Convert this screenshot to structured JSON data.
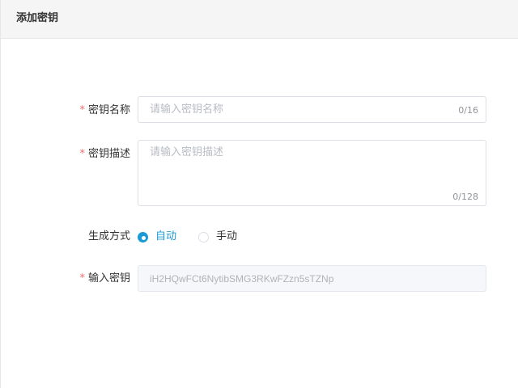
{
  "header": {
    "title": "添加密钥"
  },
  "form": {
    "name": {
      "label": "密钥名称",
      "placeholder": "请输入密钥名称",
      "counter": "0/16",
      "required": "*"
    },
    "description": {
      "label": "密钥描述",
      "placeholder": "请输入密钥描述",
      "counter": "0/128",
      "required": "*"
    },
    "mode": {
      "label": "生成方式",
      "options": [
        {
          "label": "自动",
          "checked": true
        },
        {
          "label": "手动",
          "checked": false
        }
      ]
    },
    "key": {
      "label": "输入密钥",
      "value": "iH2HQwFCt6NytibSMG3RKwFZzn5sTZNp",
      "required": "*"
    }
  },
  "colors": {
    "accent": "#1a9bd6",
    "required": "#f56c6c"
  }
}
